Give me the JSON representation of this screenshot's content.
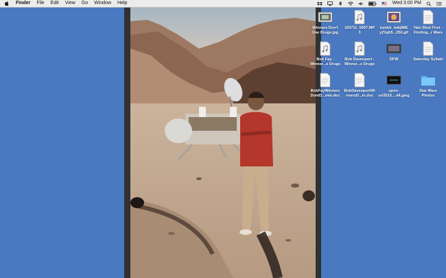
{
  "menubar": {
    "apple_icon": "apple-icon",
    "app_name": "Finder",
    "menus": [
      "File",
      "Edit",
      "View",
      "Go",
      "Window",
      "Help"
    ],
    "clock": "Wed 3:00 PM",
    "status_icons": [
      "dropbox-icon",
      "airplay-icon",
      "bluetooth-icon",
      "wifi-icon",
      "volume-icon",
      "battery-icon",
      "flag-icon",
      "search-icon",
      "list-icon"
    ]
  },
  "desktop": {
    "background_color": "#4a79c1",
    "icons": [
      {
        "label1": "Winners Don't",
        "label2": "Use Drugs.jpg",
        "icon": "image-file-icon"
      },
      {
        "label1": "150711_0007.MP",
        "label2": "3",
        "icon": "audio-file-icon"
      },
      {
        "label1": "tumblr_lwkj88E",
        "label2": "yZ1qh5...250.gif",
        "icon": "gif-file-icon"
      },
      {
        "label1": "Han Shot First -",
        "label2": "Finding...r Wars",
        "icon": "document-file-icon"
      },
      {
        "label1": "Bob Fay -",
        "label2": "Winner...e Drugs",
        "icon": "audio-file-icon"
      },
      {
        "label1": "Bob Davenport -",
        "label2": "Winner...e Drugs",
        "icon": "audio-file-icon"
      },
      {
        "label1": "DFW",
        "label2": "",
        "icon": "video-file-icon"
      },
      {
        "label1": "Saturday Syllabi",
        "label2": "",
        "icon": "document-file-icon"
      },
      {
        "label1": "BobFayWinners",
        "label2": "DontD...min.doc",
        "icon": "doc-file-icon"
      },
      {
        "label1": "BobDavenportWi",
        "label2": "nnersD...in.doc",
        "icon": "doc-file-icon"
      },
      {
        "label1": "open-",
        "label2": "uri2015....d4.jpeg",
        "icon": "image-file-icon"
      },
      {
        "label1": "Star Wars",
        "label2": "Photos",
        "icon": "folder-icon"
      }
    ]
  }
}
